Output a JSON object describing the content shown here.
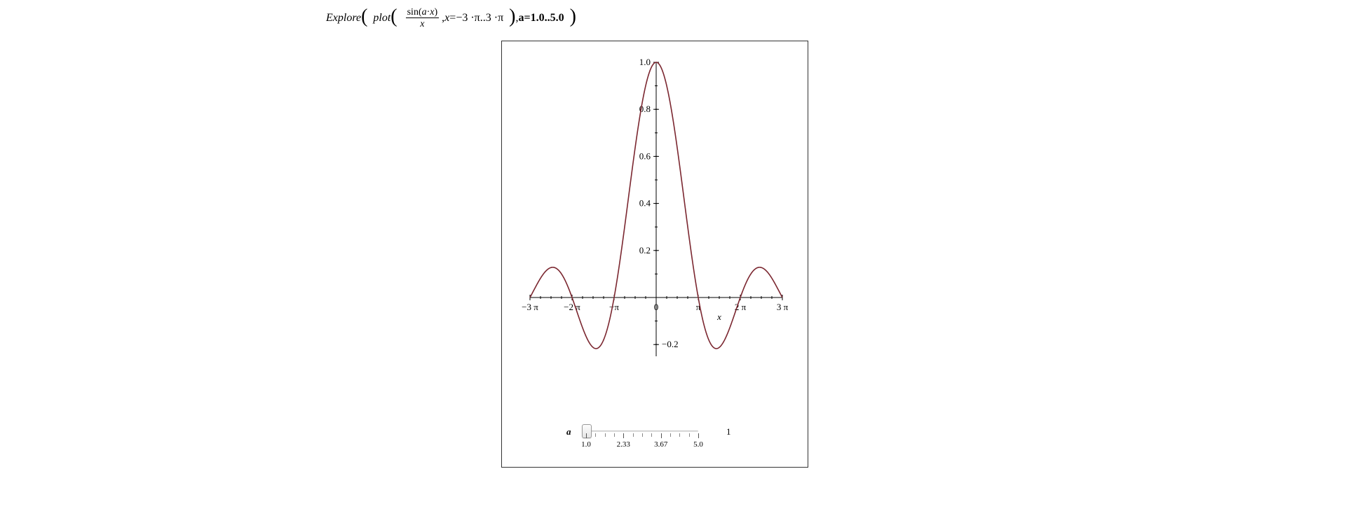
{
  "formula": {
    "fn1": "Explore",
    "fn2": "plot",
    "frac_num_prefix": "sin(",
    "frac_num_a": "a",
    "frac_num_dot": "·",
    "frac_num_x": "x",
    "frac_num_suffix": ")",
    "frac_den": "x",
    "range_lhs": "x",
    "range_eq": " =",
    "range_lo": "−3 ·π",
    "range_sep": " ..",
    "range_hi": "3 ·π",
    "param_lhs": "a",
    "param_eq": " = ",
    "param_lo": "1.0",
    "param_sep": " ..",
    "param_hi": "5.0"
  },
  "chart_data": {
    "type": "line",
    "title": "",
    "xlabel": "x",
    "ylabel": "",
    "x_range_pi": [
      -3,
      3
    ],
    "ylim": [
      -0.25,
      1.0
    ],
    "x_ticks_pi": [
      -3,
      -2,
      -1,
      0,
      1,
      2,
      3
    ],
    "x_tick_labels": [
      "−3 π",
      "−2 π",
      "−π",
      "0",
      "π",
      "2 π",
      "3 π"
    ],
    "y_ticks": [
      -0.2,
      0.2,
      0.4,
      0.6,
      0.8,
      1.0
    ],
    "minor_y_step": 0.1,
    "minor_x_step_pi": 0.25,
    "parameter": {
      "name": "a",
      "value": 1.0
    },
    "function": "sin(a*x)/x",
    "series": [
      {
        "name": "sin(a·x)/x, a=1",
        "color": "#7b2730",
        "points": []
      }
    ]
  },
  "slider": {
    "label": "a",
    "min": 1.0,
    "max": 5.0,
    "value": 1.0,
    "display_value": "1",
    "tick_labels": [
      "1.0",
      "2.33",
      "3.67",
      "5.0"
    ]
  }
}
